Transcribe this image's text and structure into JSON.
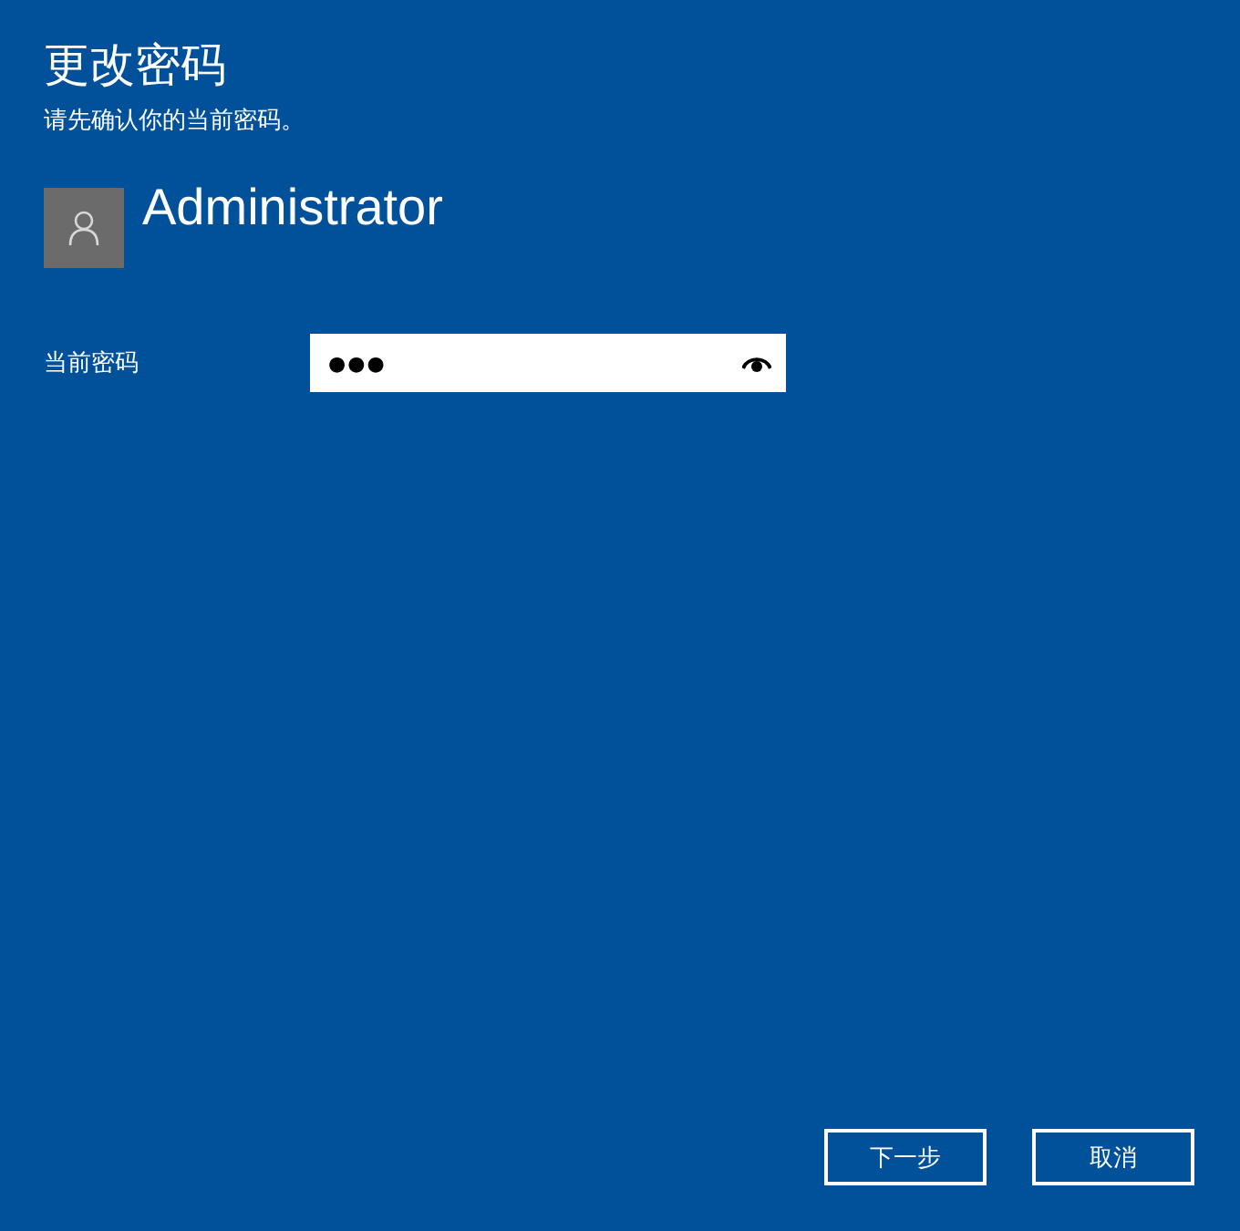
{
  "title": "更改密码",
  "subtitle": "请先确认你的当前密码。",
  "user": {
    "name": "Administrator"
  },
  "password_field": {
    "label": "当前密码",
    "value": "●●●"
  },
  "buttons": [
    {
      "label": "下一步"
    },
    {
      "label": "取消"
    }
  ]
}
